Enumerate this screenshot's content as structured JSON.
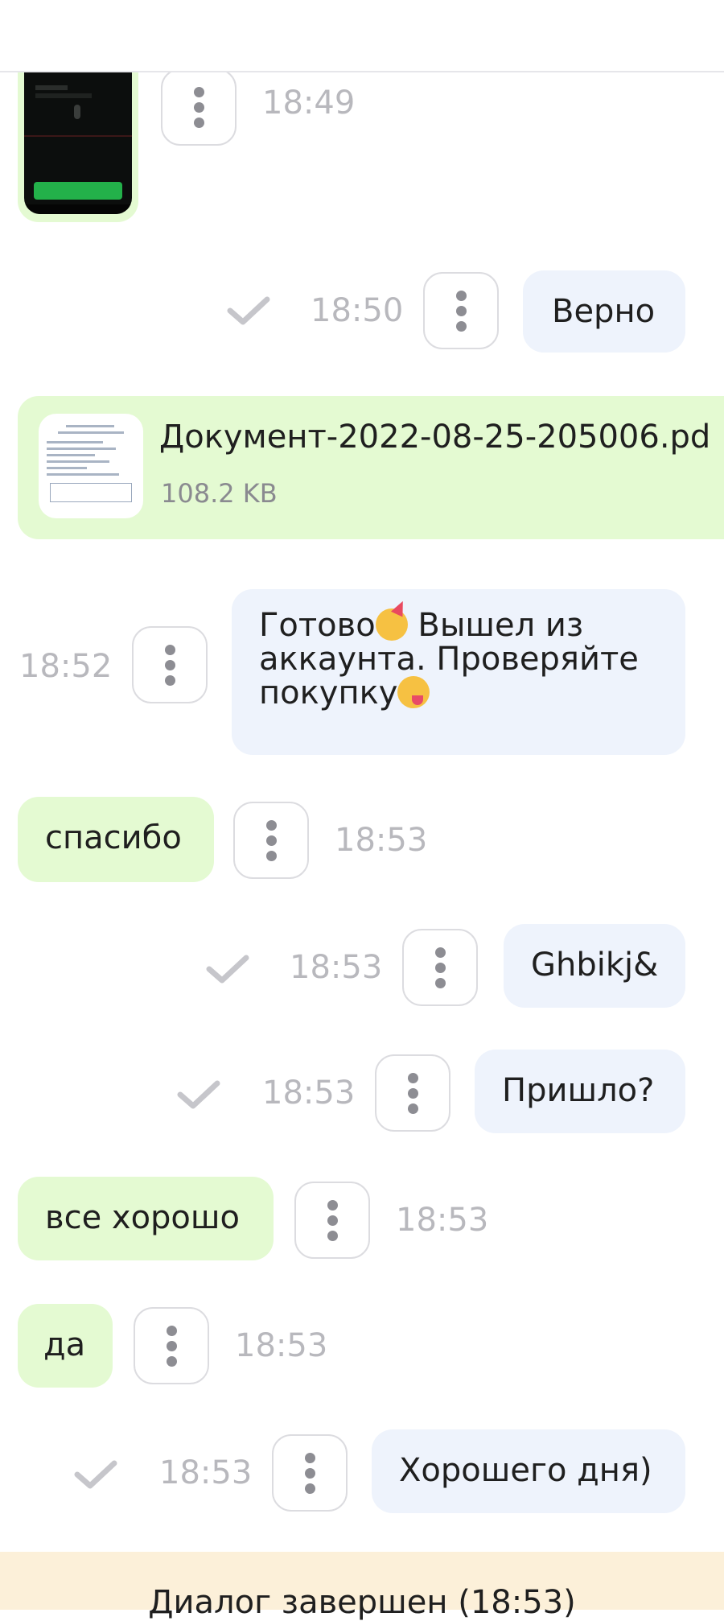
{
  "colors": {
    "incoming_bubble": "#e4fad2",
    "outgoing_bubble": "#eef3fc",
    "footer_background": "#fcf0d9",
    "timestamp": "#b8b8bd"
  },
  "messages": [
    {
      "id": "m1",
      "direction": "incoming",
      "type": "image",
      "time": "18:49"
    },
    {
      "id": "m2",
      "direction": "outgoing",
      "type": "text",
      "text": "Верно",
      "time": "18:50",
      "delivered": true
    },
    {
      "id": "m3",
      "direction": "incoming",
      "type": "file",
      "file_name": "Документ-2022-08-25-205006.pd",
      "file_size": "108.2 KB"
    },
    {
      "id": "m4",
      "direction": "outgoing",
      "type": "text",
      "line1": "Готово",
      "line1b": " Вышел из",
      "line2": "аккаунта. Проверяйте",
      "line3": "покупку",
      "emoji1": "party-face-icon",
      "emoji2": "yum-face-icon",
      "time": "18:52"
    },
    {
      "id": "m5",
      "direction": "incoming",
      "type": "text",
      "text": "спасибо",
      "time": "18:53"
    },
    {
      "id": "m6",
      "direction": "outgoing",
      "type": "text",
      "text": "Ghbikj&",
      "time": "18:53",
      "delivered": true
    },
    {
      "id": "m7",
      "direction": "outgoing",
      "type": "text",
      "text": "Пришло?",
      "time": "18:53",
      "delivered": true
    },
    {
      "id": "m8",
      "direction": "incoming",
      "type": "text",
      "text": "все хорошо",
      "time": "18:53"
    },
    {
      "id": "m9",
      "direction": "incoming",
      "type": "text",
      "text": "да",
      "time": "18:53"
    },
    {
      "id": "m10",
      "direction": "outgoing",
      "type": "text",
      "text": "Хорошего дня)",
      "time": "18:53",
      "delivered": true
    }
  ],
  "footer": {
    "status_text": "Диалог завершен (18:53)"
  }
}
